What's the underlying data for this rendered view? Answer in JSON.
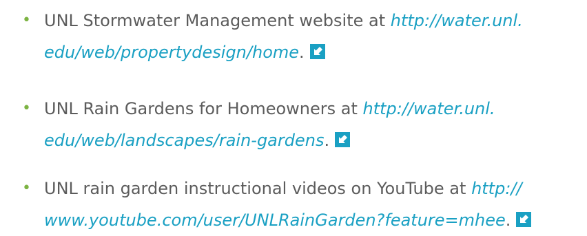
{
  "resources": [
    {
      "bullet": "•",
      "text": "UNL Stormwater Management website at ",
      "link": "http://water.unl.edu/web/propertydesign/home",
      "link_line1": "http://water.unl.",
      "link_line2": "edu/web/propertydesign/home",
      "trailing": ".",
      "icon": "external-link-icon"
    },
    {
      "bullet": "•",
      "text": "UNL Rain Gardens for Homeowners at ",
      "link": "http://water.unl.edu/web/landscapes/rain-gardens",
      "link_line1": "http://water.unl.",
      "link_line2": "edu/web/landscapes/rain-gardens",
      "trailing": ".",
      "icon": "external-link-icon"
    },
    {
      "bullet": "•",
      "text": "UNL rain garden instructional videos on YouTube at ",
      "link": "http://www.youtube.com/user/UNLRainGarden?feature=mhee",
      "link_line1": "http://",
      "link_line2": "www.youtube.com/user/UNLRainGarden?feature=mhee",
      "trailing": ".",
      "icon": "external-link-icon"
    }
  ],
  "colors": {
    "bullet": "#7cb342",
    "body_text": "#5c5c5c",
    "link": "#1aa0c3",
    "icon_bg": "#1aa0c3"
  }
}
